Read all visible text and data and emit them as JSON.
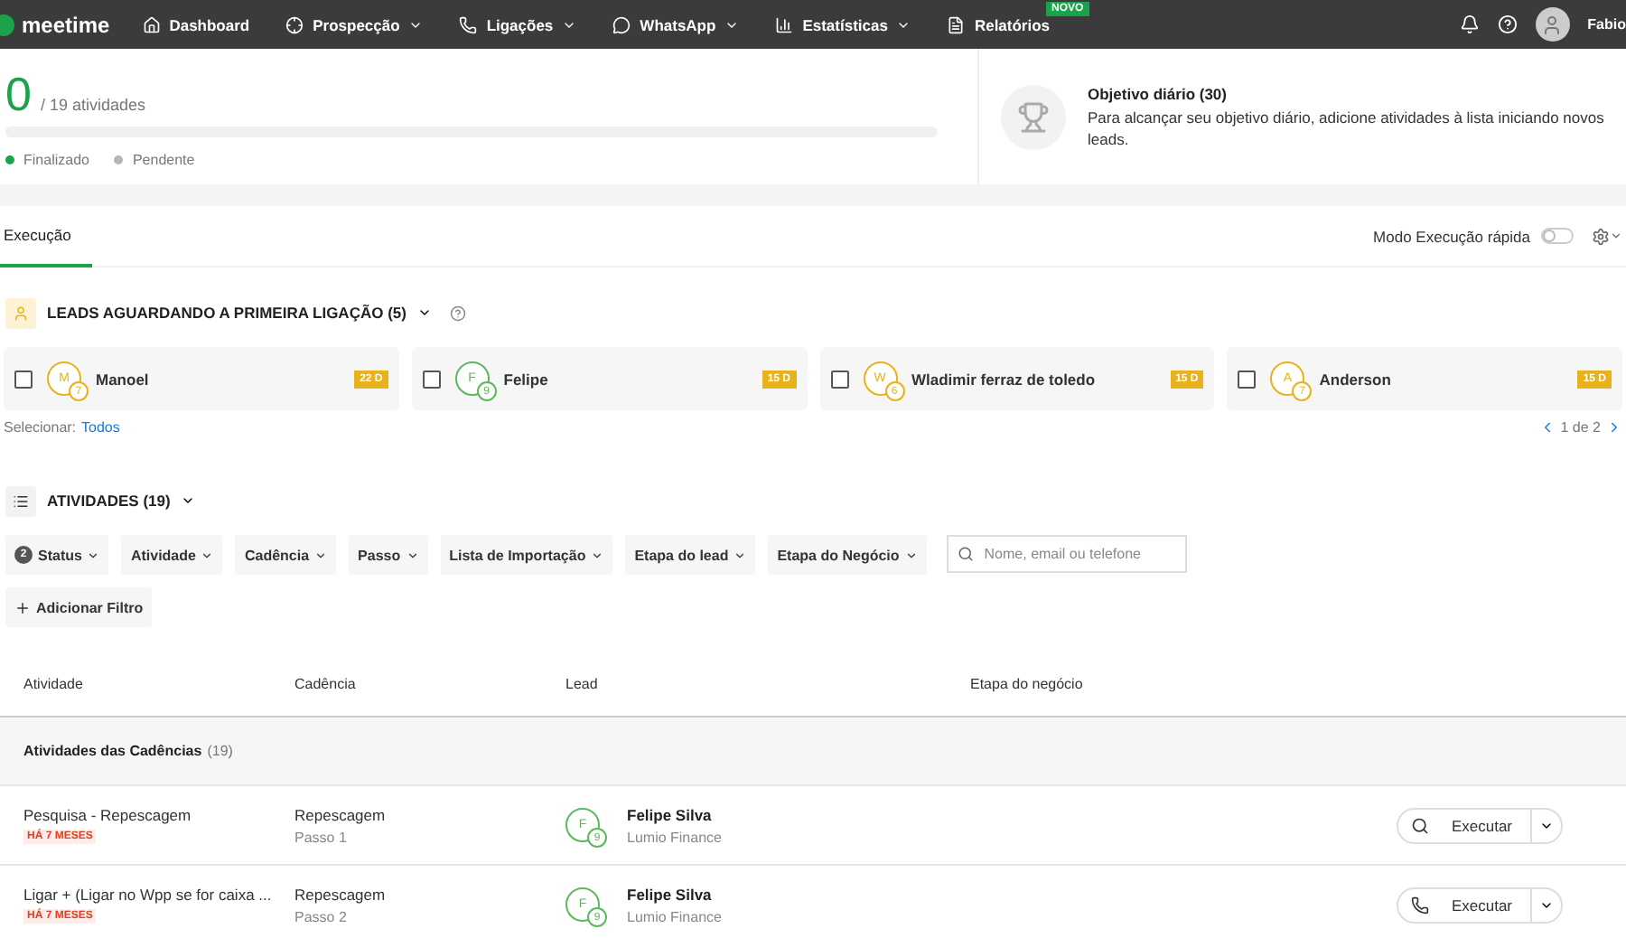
{
  "nav": {
    "brand": "meetime",
    "items": [
      {
        "label": "Dashboard",
        "caret": false
      },
      {
        "label": "Prospecção",
        "caret": true
      },
      {
        "label": "Ligações",
        "caret": true
      },
      {
        "label": "WhatsApp",
        "caret": true
      },
      {
        "label": "Estatísticas",
        "caret": true
      },
      {
        "label": "Relatórios",
        "caret": false,
        "badge": "NOVO"
      }
    ],
    "user": "Fabio"
  },
  "progress": {
    "done": "0",
    "total": "/ 19 atividades",
    "level": 0,
    "legend": [
      {
        "label": "Finalizado",
        "color": "#1aa34a"
      },
      {
        "label": "Pendente",
        "color": "#b5b5b5"
      }
    ]
  },
  "goal": {
    "title": "Objetivo diário (30)",
    "text": "Para alcançar seu objetivo diário, adicione atividades à lista iniciando novos leads."
  },
  "tabs": [
    {
      "label": "Execução",
      "selected": true
    }
  ],
  "quick_mode": {
    "label": "Modo Execução rápida",
    "on": false
  },
  "leads": {
    "title": "LEADS AGUARDANDO A PRIMEIRA LIGAÇÃO (5)",
    "cards": [
      {
        "initial": "M",
        "count": "7",
        "name": "Manoel",
        "days": "22 D",
        "checked": false,
        "color": "#e8b21c"
      },
      {
        "initial": "F",
        "count": "9",
        "name": "Felipe",
        "days": "15 D",
        "checked": false,
        "color": "#5cb85c"
      },
      {
        "initial": "W",
        "count": "6",
        "name": "Wladimir ferraz de toledo",
        "days": "15 D",
        "checked": false,
        "color": "#e8b21c"
      },
      {
        "initial": "A",
        "count": "7",
        "name": "Anderson",
        "days": "15 D",
        "checked": false,
        "color": "#e8b21c"
      }
    ],
    "select_label": "Selecionar:",
    "select_all": "Todos",
    "pager": "1 de 2"
  },
  "activities": {
    "title": "ATIVIDADES (19)",
    "filters": [
      {
        "label": "Status",
        "count": "2"
      },
      {
        "label": "Atividade"
      },
      {
        "label": "Cadência"
      },
      {
        "label": "Passo"
      },
      {
        "label": "Lista de Importação"
      },
      {
        "label": "Etapa do lead"
      },
      {
        "label": "Etapa do Negócio"
      }
    ],
    "search_placeholder": "Nome, email ou telefone",
    "add_filter": "Adicionar Filtro",
    "columns": [
      "Atividade",
      "Cadência",
      "Lead",
      "Etapa do negócio"
    ],
    "group": {
      "title": "Atividades das Cadências",
      "count": "(19)"
    },
    "rows": [
      {
        "activity": "Pesquisa - Repescagem",
        "age": "HÁ 7 MESES",
        "cadence": "Repescagem",
        "step": "Passo 1",
        "initial": "F",
        "count": "9",
        "lead": "Felipe Silva",
        "company": "Lumio Finance",
        "action": "Executar",
        "kind": "search"
      },
      {
        "activity": "Ligar + (Ligar no Wpp se for caixa ...",
        "age": "HÁ 7 MESES",
        "cadence": "Repescagem",
        "step": "Passo 2",
        "initial": "F",
        "count": "9",
        "lead": "Felipe Silva",
        "company": "Lumio Finance",
        "action": "Executar",
        "kind": "call"
      }
    ]
  }
}
